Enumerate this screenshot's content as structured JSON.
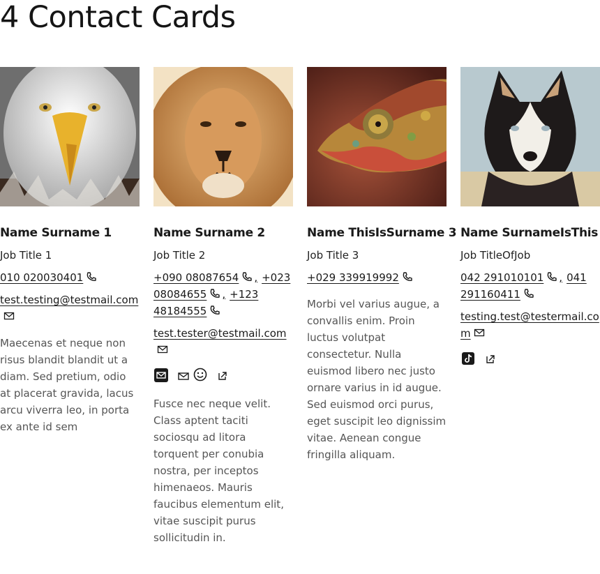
{
  "page": {
    "title": "4 Contact Cards"
  },
  "cards": [
    {
      "name": "Name Surname 1",
      "job": "Job Title 1",
      "phones": [
        "010 020030401"
      ],
      "email": "test.testing@testmail.com",
      "description": "Maecenas et neque non risus blandit blandit ut a diam. Sed pretium, odio at placerat gravida, lacus arcu viverra leo, in porta ex ante id sem",
      "photo": "eagle",
      "socials": []
    },
    {
      "name": "Name Surname 2",
      "job": "Job Title 2",
      "phones": [
        "+090 08087654",
        "+023 08084655",
        "+123 48184555"
      ],
      "email": "test.tester@testmail.com",
      "description": "Fusce nec neque velit. Class aptent taciti sociosqu ad litora torquent per conubia nostra, per inceptos himenaeos. Mauris faucibus elementum elit, vitae suscipit purus sollicitudin in.",
      "photo": "lion",
      "socials": [
        "mail-square-icon",
        "mail-icon",
        "smiley-icon",
        "external-link-icon"
      ]
    },
    {
      "name": "Name ThisIsSurname 3",
      "job": "Job Title 3",
      "phones": [
        "+029 339919992"
      ],
      "email": "",
      "description": "Morbi vel varius augue, a convallis enim. Proin luctus volutpat consectetur. Nulla euismod libero nec justo ornare varius in id augue. Sed euismod orci purus, eget suscipit leo dignissim vitae. Aenean congue fringilla aliquam.",
      "photo": "chameleon",
      "socials": []
    },
    {
      "name": "Name SurnameIsThis",
      "job": "Job TitleOfJob",
      "phones": [
        "042 291010101",
        "041 291160411"
      ],
      "email": "testing.test@testermail.com",
      "description": "",
      "photo": "husky",
      "socials": [
        "tiktok-icon",
        "external-link-icon"
      ]
    }
  ]
}
